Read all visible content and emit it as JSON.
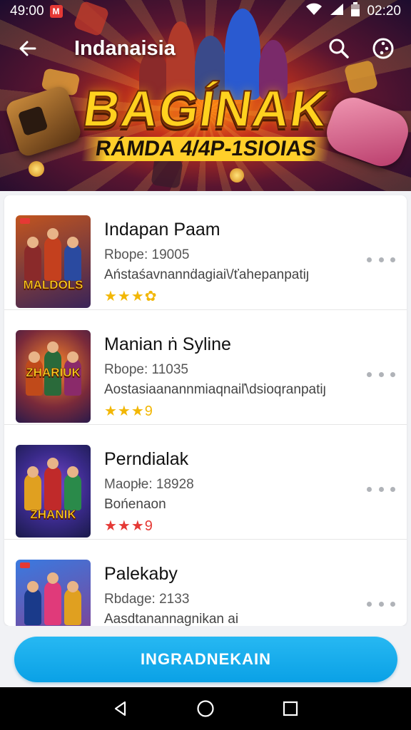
{
  "status_bar": {
    "time": "49:00",
    "notification_badge": "M",
    "clock": "02:20",
    "icons": [
      "wifi-icon",
      "signal-icon",
      "battery-icon"
    ]
  },
  "app_bar": {
    "title": "Indanaisia",
    "back_icon": "arrow-left-icon",
    "actions": [
      "search-icon",
      "more-circle-icon"
    ]
  },
  "banner": {
    "title": "BAGÍNAK",
    "subtitle": "RÁMDA 4/4P-1SIOIAS"
  },
  "games": [
    {
      "name": "Indapan Paam",
      "meta": "Rbope:  19005",
      "desc": "Aństaśavnannḋagiai\\/ťahepanpatiȷ",
      "stars": "★★★",
      "star_partial": "✿",
      "star_color": "#f2b705",
      "thumb_text": "MALDOLS",
      "thumb_bg": [
        "#b04a1e",
        "#4a2a6a"
      ]
    },
    {
      "name": "Manian ṅ Syline",
      "meta": "Rbope:  11035",
      "desc": "Aostasiaanannmiaqnaiľ\\dsioqranpatiȷ",
      "stars": "★★★",
      "star_partial": "9",
      "star_color": "#f2b705",
      "thumb_text": "ZHARIUK",
      "thumb_bg": [
        "#e0602a",
        "#3a2a5a"
      ]
    },
    {
      "name": "Perndialak",
      "meta": "Maopłe:  18928",
      "desc": "Bońenaon",
      "stars": "★★★",
      "star_partial": "9",
      "star_color": "#e53935",
      "thumb_text": "ZHANIK",
      "thumb_bg": [
        "#2a3a9a",
        "#7a2a7a"
      ]
    },
    {
      "name": "Palekaby",
      "meta": "Rbdage:  2133",
      "desc": "Aasdtanannagnikan ai",
      "stars": "",
      "star_partial": "",
      "star_color": "#f2b705",
      "thumb_text": "",
      "thumb_bg": [
        "#3a6ad0",
        "#9a3a7a"
      ]
    }
  ],
  "cta": {
    "label": "INGRADNEKAIN"
  },
  "nav_bar": {
    "icons": [
      "back-triangle-icon",
      "home-circle-icon",
      "recents-square-icon"
    ]
  }
}
